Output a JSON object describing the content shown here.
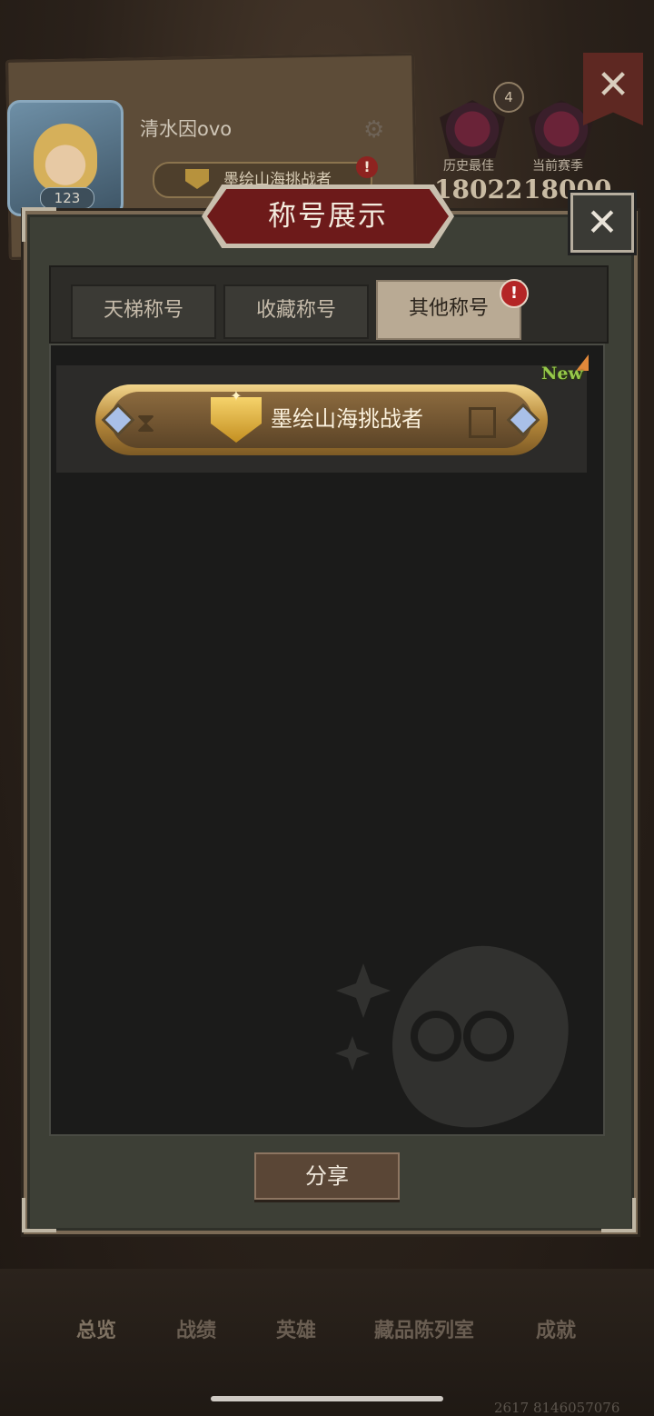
{
  "profile": {
    "username": "清水因ovo",
    "level": "123",
    "equipped_title": "墨绘山海挑战者",
    "crown_count": "4",
    "best_label": "历史最佳",
    "best_score": "18022",
    "season_label": "当前赛季",
    "season_score": "18000"
  },
  "modal": {
    "title": "称号展示",
    "tabs": [
      {
        "label": "天梯称号"
      },
      {
        "label": "收藏称号"
      },
      {
        "label": "其他称号"
      }
    ],
    "active_tab_index": 2,
    "titles": [
      {
        "name": "墨绘山海挑战者",
        "badge": "New"
      }
    ],
    "share_label": "分享"
  },
  "bottom_nav": [
    {
      "label": "总览"
    },
    {
      "label": "战绩"
    },
    {
      "label": "英雄"
    },
    {
      "label": "藏品陈列室"
    },
    {
      "label": "成就"
    }
  ],
  "uid": "2617 8146057076",
  "colors": {
    "header_red": "#6d1a1a",
    "gold": "#c38f21",
    "new_green": "#96c94a",
    "alert_red": "#b42626"
  }
}
